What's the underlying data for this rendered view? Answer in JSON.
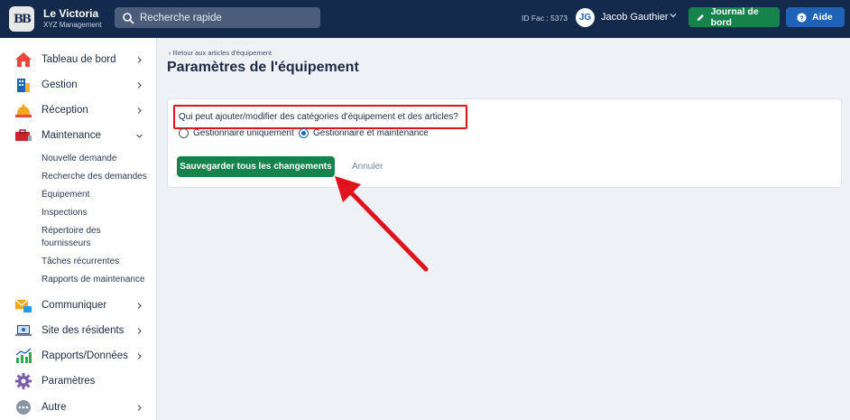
{
  "header": {
    "brand_name": "Le Victoria",
    "brand_sub": "XYZ Management",
    "search_placeholder": "Recherche rapide",
    "fac_id": "ID Fac : 5373",
    "user_initials": "JG",
    "user_name": "Jacob Gauthier",
    "journal_label": "Journal de bord",
    "help_label": "Aide"
  },
  "sidebar": {
    "items": [
      {
        "label": "Tableau de bord",
        "icon": "home-icon"
      },
      {
        "label": "Gestion",
        "icon": "building-icon"
      },
      {
        "label": "Réception",
        "icon": "reception-bell-icon"
      },
      {
        "label": "Maintenance",
        "icon": "toolbox-icon"
      },
      {
        "label": "Communiquer",
        "icon": "envelope-chat-icon"
      },
      {
        "label": "Site des résidents",
        "icon": "laptop-icon"
      },
      {
        "label": "Rapports/Données",
        "icon": "bar-chart-icon"
      },
      {
        "label": "Paramètres",
        "icon": "gear-icon"
      },
      {
        "label": "Autre",
        "icon": "more-icon"
      }
    ],
    "maintenance_sub": [
      "Nouvelle demande",
      "Recherche des demandes",
      "Équipement",
      "Inspections",
      "Répertoire des",
      "fournisseurs",
      "Tâches récurrentes",
      "Rapports de maintenance"
    ]
  },
  "main": {
    "back_link": "‹ Retour aux articles d'équipement",
    "title": "Paramètres de l'équipement",
    "question": "Qui peut ajouter/modifier des catégories d'équipement et des articles?",
    "options": [
      {
        "label": "Gestionnaire uniquement",
        "selected": false
      },
      {
        "label": "Gestionnaire et maintenance",
        "selected": true
      }
    ],
    "save_label": "Sauvegarder tous les changements",
    "cancel_label": "Annuler"
  },
  "colors": {
    "topbar": "#142a4c",
    "primary_green": "#16834d",
    "primary_blue": "#1e63b8",
    "annotation_red": "#e0121c"
  }
}
